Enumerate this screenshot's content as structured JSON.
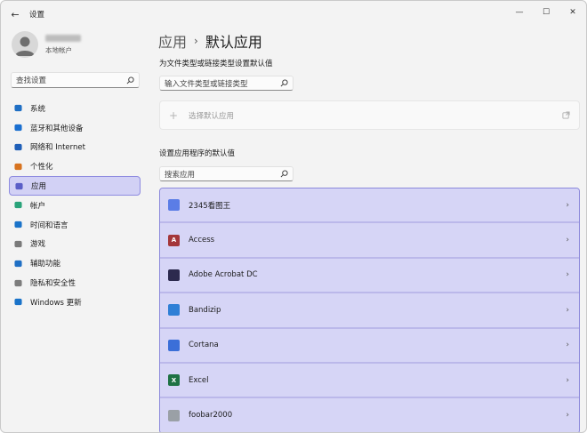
{
  "window": {
    "title": "设置",
    "controls": {
      "minimize": "—",
      "maximize": "☐",
      "close": "✕"
    }
  },
  "profile": {
    "name": "redacted",
    "subtitle": "本地帐户"
  },
  "sidebar": {
    "search_placeholder": "查找设置",
    "items": [
      {
        "label": "系统",
        "icon": "system-icon",
        "color": "#1f6fc4",
        "active": false
      },
      {
        "label": "蓝牙和其他设备",
        "icon": "bluetooth-icon",
        "color": "#1a6fd0",
        "active": false
      },
      {
        "label": "网络和 Internet",
        "icon": "wifi-icon",
        "color": "#1f5fb8",
        "active": false
      },
      {
        "label": "个性化",
        "icon": "brush-icon",
        "color": "#d7731f",
        "active": false
      },
      {
        "label": "应用",
        "icon": "apps-icon",
        "color": "#5b5fc7",
        "active": true
      },
      {
        "label": "帐户",
        "icon": "account-icon",
        "color": "#2aa37a",
        "active": false
      },
      {
        "label": "时间和语言",
        "icon": "time-language-icon",
        "color": "#1a73c9",
        "active": false
      },
      {
        "label": "游戏",
        "icon": "gamepad-icon",
        "color": "#7a7a7a",
        "active": false
      },
      {
        "label": "辅助功能",
        "icon": "accessibility-icon",
        "color": "#1f6fc4",
        "active": false
      },
      {
        "label": "隐私和安全性",
        "icon": "shield-icon",
        "color": "#7d7d7d",
        "active": false
      },
      {
        "label": "Windows 更新",
        "icon": "update-icon",
        "color": "#1a73c9",
        "active": false
      }
    ]
  },
  "main": {
    "breadcrumb": {
      "parent": "应用",
      "separator": "›",
      "current": "默认应用"
    },
    "file_type_section": {
      "title": "为文件类型或链接类型设置默认值",
      "search_placeholder": "输入文件类型或链接类型"
    },
    "choose_default": {
      "plus": "+",
      "label": "选择默认应用"
    },
    "apps_section": {
      "title": "设置应用程序的默认值",
      "search_placeholder": "搜索应用"
    },
    "apps": [
      {
        "name": "2345看图王",
        "icon": "2345-viewer-icon",
        "color": "#5b7de6",
        "glyph": ""
      },
      {
        "name": "Access",
        "icon": "access-icon",
        "color": "#a4373a",
        "glyph": "A"
      },
      {
        "name": "Adobe Acrobat DC",
        "icon": "acrobat-icon",
        "color": "#2c2a4e",
        "glyph": ""
      },
      {
        "name": "Bandizip",
        "icon": "bandizip-icon",
        "color": "#2f7fd6",
        "glyph": ""
      },
      {
        "name": "Cortana",
        "icon": "cortana-icon",
        "color": "#3b6fd8",
        "glyph": ""
      },
      {
        "name": "Excel",
        "icon": "excel-icon",
        "color": "#1f7244",
        "glyph": "X"
      },
      {
        "name": "foobar2000",
        "icon": "foobar2000-icon",
        "color": "#9aa0a6",
        "glyph": ""
      }
    ]
  }
}
